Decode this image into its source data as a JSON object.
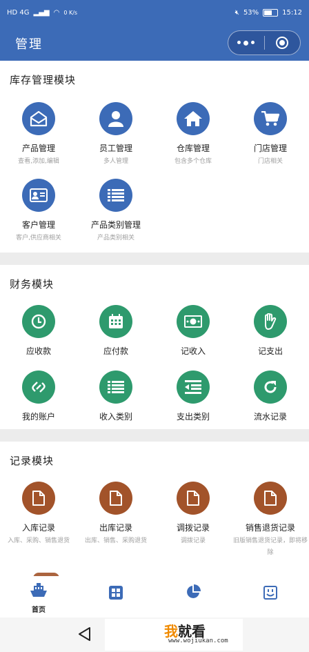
{
  "status_bar": {
    "network": "HD 4G",
    "speed": "0 K/s",
    "battery": "53%",
    "time": "15:12"
  },
  "nav": {
    "title": "管理"
  },
  "colors": {
    "primary": "#3c6bb7",
    "finance": "#2e9a6d",
    "records": "#a2532a"
  },
  "inventory": {
    "title": "库存管理模块",
    "items": [
      {
        "label": "产品管理",
        "sub": "查看,添加,编辑",
        "icon": "envelope-open-icon"
      },
      {
        "label": "员工管理",
        "sub": "多人管理",
        "icon": "user-icon"
      },
      {
        "label": "仓库管理",
        "sub": "包含多个仓库",
        "icon": "home-icon"
      },
      {
        "label": "门店管理",
        "sub": "门店相关",
        "icon": "cart-icon"
      },
      {
        "label": "客户管理",
        "sub": "客户,供应商相关",
        "icon": "contact-card-icon"
      },
      {
        "label": "产品类别管理",
        "sub": "产品类别相关",
        "icon": "list-icon"
      }
    ]
  },
  "finance": {
    "title": "财务模块",
    "items": [
      {
        "label": "应收款",
        "icon": "clock-icon"
      },
      {
        "label": "应付款",
        "icon": "calendar-icon"
      },
      {
        "label": "记收入",
        "icon": "money-icon"
      },
      {
        "label": "记支出",
        "icon": "hand-icon"
      },
      {
        "label": "我的账户",
        "icon": "link-icon"
      },
      {
        "label": "收入类别",
        "icon": "list-icon"
      },
      {
        "label": "支出类别",
        "icon": "outdent-icon"
      },
      {
        "label": "流水记录",
        "icon": "refresh-icon"
      }
    ]
  },
  "records": {
    "title": "记录模块",
    "items": [
      {
        "label": "入库记录",
        "sub": "入库、采购、销售退货",
        "icon": "file-icon"
      },
      {
        "label": "出库记录",
        "sub": "出库、销售、采购退货",
        "icon": "file-icon"
      },
      {
        "label": "调拨记录",
        "sub": "调拨记录",
        "icon": "file-icon"
      },
      {
        "label": "销售退货记录",
        "sub": "旧版销售退货记录，即将移除",
        "icon": "file-icon"
      }
    ]
  },
  "tabbar": {
    "items": [
      {
        "label": "首页",
        "icon": "ship-icon"
      },
      {
        "label": "",
        "icon": "apps-icon"
      },
      {
        "label": "",
        "icon": "pie-chart-icon"
      },
      {
        "label": "",
        "icon": "smile-box-icon"
      }
    ]
  },
  "watermark": {
    "brand_orange": "我",
    "brand_rest": "就看",
    "url": "www.wojiukan.com"
  }
}
